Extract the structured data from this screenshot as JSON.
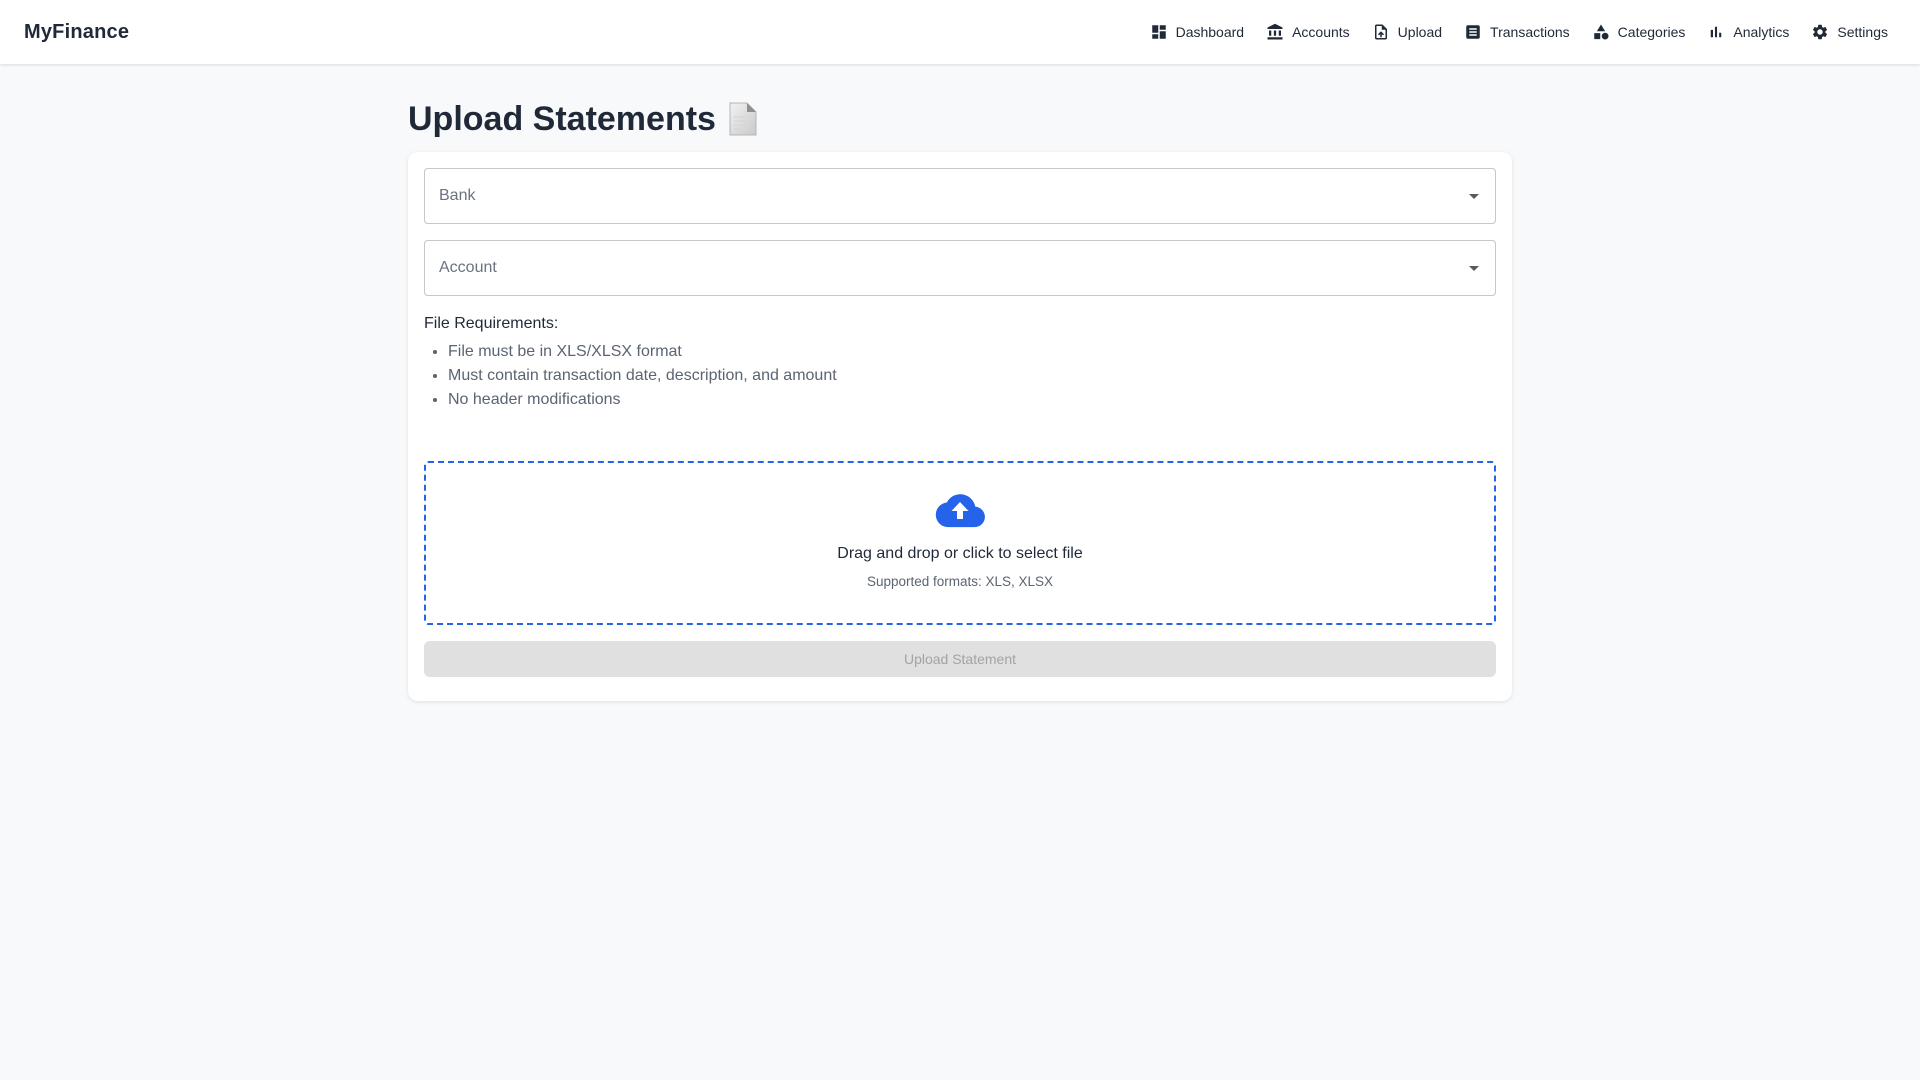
{
  "app": {
    "brand": "MyFinance"
  },
  "nav": {
    "items": [
      {
        "label": "Dashboard",
        "icon": "dashboard-icon"
      },
      {
        "label": "Accounts",
        "icon": "bank-icon"
      },
      {
        "label": "Upload",
        "icon": "file-upload-icon"
      },
      {
        "label": "Transactions",
        "icon": "list-icon"
      },
      {
        "label": "Categories",
        "icon": "shapes-icon"
      },
      {
        "label": "Analytics",
        "icon": "bar-chart-icon"
      },
      {
        "label": "Settings",
        "icon": "gear-icon"
      }
    ]
  },
  "page": {
    "title": "Upload Statements",
    "title_icon": "document-icon"
  },
  "form": {
    "bank": {
      "placeholder": "Bank"
    },
    "account": {
      "placeholder": "Account"
    },
    "requirements": {
      "title": "File Requirements:",
      "items": [
        "File must be in XLS/XLSX format",
        "Must contain transaction date, description, and amount",
        "No header modifications"
      ]
    },
    "dropzone": {
      "icon": "cloud-upload-icon",
      "text": "Drag and drop or click to select file",
      "subtext": "Supported formats: XLS, XLSX"
    },
    "submit_label": "Upload Statement"
  },
  "colors": {
    "accent": "#2563eb",
    "disabled_bg": "#e0e0e0",
    "disabled_text": "#a3a3a3",
    "page_bg": "#f8f9fb"
  }
}
